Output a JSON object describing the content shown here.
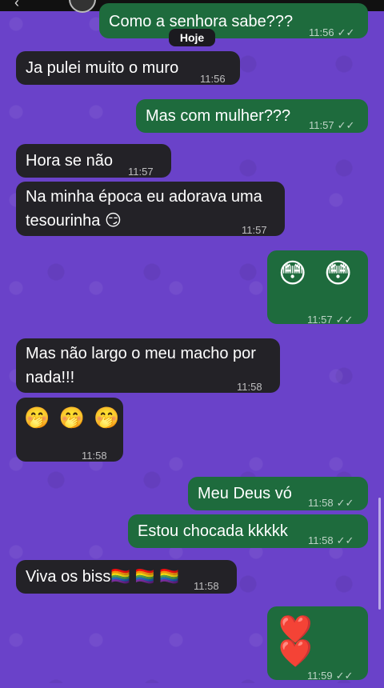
{
  "date_chip": "Hoje",
  "messages": [
    {
      "text": "Como a senhora sabe???",
      "time": "11:56",
      "ticks": "✓✓"
    },
    {
      "text": "Ja pulei muito o muro",
      "time": "11:56"
    },
    {
      "text": "Mas com mulher???",
      "time": "11:57",
      "ticks": "✓✓"
    },
    {
      "text": "Hora se não",
      "time": "11:57"
    },
    {
      "text": "Na minha época eu adorava uma tesourinha 😏",
      "time": "11:57"
    },
    {
      "text": "😳 😳",
      "time": "11:57",
      "ticks": "✓✓"
    },
    {
      "text": "Mas não largo o meu macho por nada!!!",
      "time": "11:58"
    },
    {
      "text": "🤭 🤭 🤭",
      "time": "11:58"
    },
    {
      "text": "Meu Deus vó",
      "time": "11:58",
      "ticks": "✓✓"
    },
    {
      "text": "Estou chocada kkkkk",
      "time": "11:58",
      "ticks": "✓✓"
    },
    {
      "text": "Viva os biss🏳️‍🌈 🏳️‍🌈 🏳️‍🌈",
      "time": "11:58"
    },
    {
      "text": "❤️ ❤️",
      "time": "11:59",
      "ticks": "✓✓"
    }
  ],
  "colors": {
    "wallpaper": "#6a42c9",
    "incoming": "#232227",
    "outgoing": "#1e6b3d"
  },
  "icons": {
    "back": "chevron-left-icon",
    "read": "double-check-icon"
  }
}
